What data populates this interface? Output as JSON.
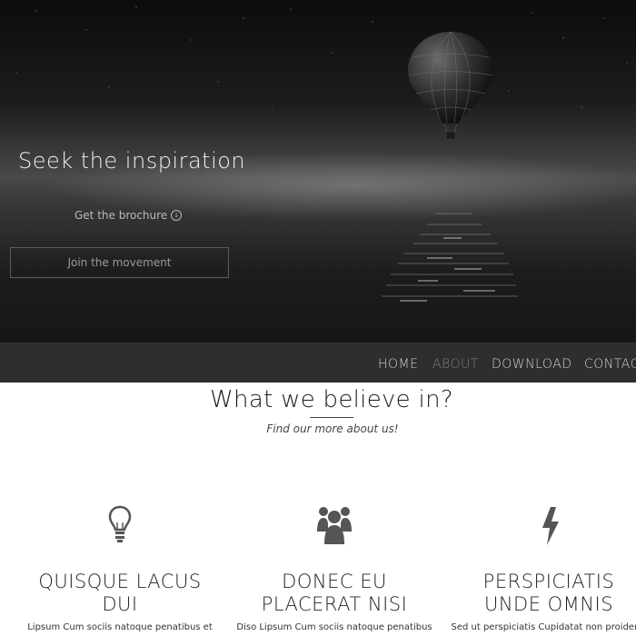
{
  "hero": {
    "title": "Seek the inspiration",
    "brochure_label": "Get the brochure",
    "join_label": "Join the movement",
    "brochure_icon": "download-circle-icon",
    "image": "hot-air-balloon-over-sea-night"
  },
  "nav": {
    "items": [
      {
        "label": "HOME",
        "active": false
      },
      {
        "label": "ABOUT",
        "active": true
      },
      {
        "label": "DOWNLOAD",
        "active": false
      },
      {
        "label": "CONTAC",
        "active": false
      }
    ]
  },
  "section": {
    "title": "What we believe in?",
    "subtitle": "Find our more about us!"
  },
  "features": [
    {
      "icon": "lightbulb-icon",
      "title_line1": "QUISQUE LACUS",
      "title_line2": "DUI",
      "text": "Lipsum Cum sociis natoque penatibus et"
    },
    {
      "icon": "users-group-icon",
      "title_line1": "DONEC EU",
      "title_line2": "PLACERAT NISI",
      "text": "Diso Lipsum Cum sociis natoque penatibus"
    },
    {
      "icon": "lightning-icon",
      "title_line1": "PERSPICIATIS",
      "title_line2": "UNDE OMNIS",
      "text": "Sed ut perspiciatis Cupidatat non proident,"
    }
  ],
  "colors": {
    "hero_dark": "#161616",
    "navbar": "#2e2e2e",
    "nav_text": "#cfcfcf",
    "nav_active": "#7d7d7d",
    "icon": "#555555"
  }
}
